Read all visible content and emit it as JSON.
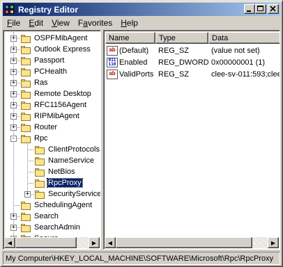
{
  "window": {
    "title": "Registry Editor"
  },
  "menu": [
    {
      "label": "File",
      "u": "F",
      "rest": "ile"
    },
    {
      "label": "Edit",
      "u": "E",
      "rest": "dit"
    },
    {
      "label": "View",
      "u": "V",
      "rest": "iew"
    },
    {
      "label": "Favorites",
      "u": "",
      "rest": "Favorites",
      "pre": "F",
      "u2": "a",
      "rest2": "vorites"
    },
    {
      "label": "Help",
      "u": "H",
      "rest": "elp"
    }
  ],
  "tree": {
    "items": [
      {
        "label": "OSPFMibAgent",
        "level": 1,
        "expander": "+"
      },
      {
        "label": "Outlook Express",
        "level": 1,
        "expander": "+"
      },
      {
        "label": "Passport",
        "level": 1,
        "expander": "+"
      },
      {
        "label": "PCHealth",
        "level": 1,
        "expander": "+"
      },
      {
        "label": "Ras",
        "level": 1,
        "expander": "+"
      },
      {
        "label": "Remote Desktop",
        "level": 1,
        "expander": "+"
      },
      {
        "label": "RFC1156Agent",
        "level": 1,
        "expander": "+"
      },
      {
        "label": "RIPMibAgent",
        "level": 1,
        "expander": "+"
      },
      {
        "label": "Router",
        "level": 1,
        "expander": "+"
      },
      {
        "label": "Rpc",
        "level": 1,
        "expander": "-"
      },
      {
        "label": "ClientProtocols",
        "level": 2,
        "expander": ""
      },
      {
        "label": "NameService",
        "level": 2,
        "expander": ""
      },
      {
        "label": "NetBios",
        "level": 2,
        "expander": ""
      },
      {
        "label": "RpcProxy",
        "level": 2,
        "expander": "",
        "selected": true
      },
      {
        "label": "SecurityService",
        "level": 2,
        "expander": "+"
      },
      {
        "label": "SchedulingAgent",
        "level": 1,
        "expander": ""
      },
      {
        "label": "Search",
        "level": 1,
        "expander": "+"
      },
      {
        "label": "SearchAdmin",
        "level": 1,
        "expander": "+"
      },
      {
        "label": "Secure",
        "level": 1,
        "expander": "+"
      }
    ]
  },
  "list": {
    "columns": [
      "Name",
      "Type",
      "Data"
    ],
    "rows": [
      {
        "icon": "string-value-icon",
        "name": "(Default)",
        "type": "REG_SZ",
        "data": "(value not set)"
      },
      {
        "icon": "dword-value-icon",
        "name": "Enabled",
        "type": "REG_DWORD",
        "data": "0x00000001 (1)"
      },
      {
        "icon": "string-value-icon",
        "name": "ValidPorts",
        "type": "REG_SZ",
        "data": "clee-sv-011:593;clee"
      }
    ]
  },
  "status": {
    "path": "My Computer\\HKEY_LOCAL_MACHINE\\SOFTWARE\\Microsoft\\Rpc\\RpcProxy"
  },
  "colors": {
    "titlebar_start": "#0a246a",
    "titlebar_end": "#a6caf0",
    "selection": "#0a246a",
    "folder": "#ffe48b"
  }
}
